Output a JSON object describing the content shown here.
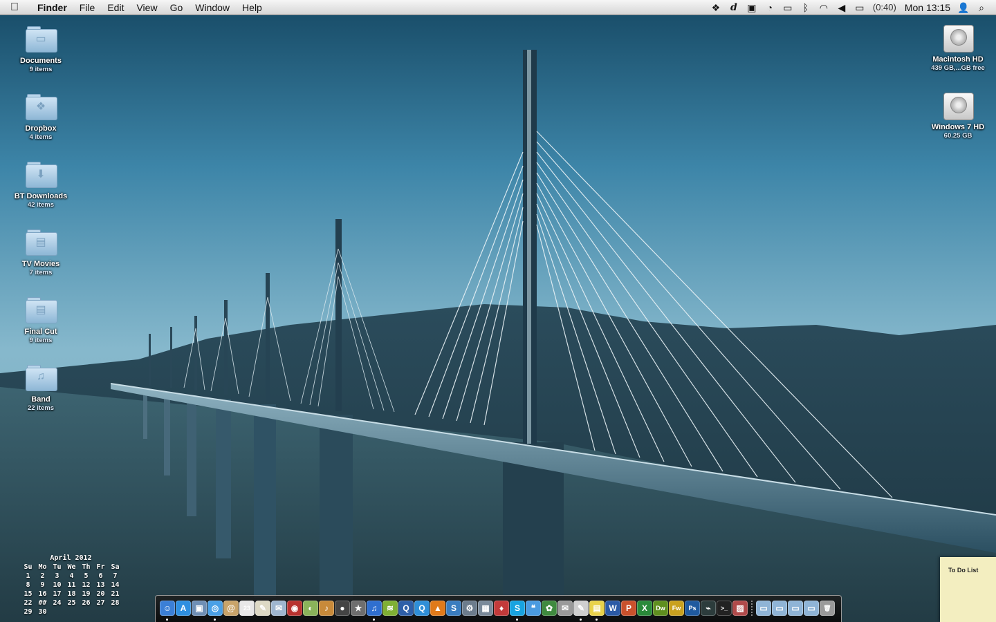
{
  "menubar": {
    "apple_icon": "apple-logo-icon",
    "app_name": "Finder",
    "menus": [
      "File",
      "Edit",
      "View",
      "Go",
      "Window",
      "Help"
    ],
    "status_icons": [
      "dropbox-icon",
      "dashcode-icon",
      "airplay-icon",
      "time-machine-icon",
      "display-icon",
      "bluetooth-icon",
      "wifi-icon",
      "volume-icon"
    ],
    "battery_icon": "battery-charging-icon",
    "battery_time": "(0:40)",
    "clock": "Mon 13:15",
    "user_icon": "user-icon",
    "spotlight_icon": "spotlight-icon"
  },
  "desktop_left": [
    {
      "name": "Documents",
      "sub": "9 items",
      "icon": "folder-documents-icon",
      "mark": "▭"
    },
    {
      "name": "Dropbox",
      "sub": "4 items",
      "icon": "folder-dropbox-icon",
      "mark": "❖"
    },
    {
      "name": "BT Downloads",
      "sub": "42 items",
      "icon": "folder-downloads-icon",
      "mark": "⬇"
    },
    {
      "name": "TV Movies",
      "sub": "7 items",
      "icon": "folder-movies-icon",
      "mark": "▤"
    },
    {
      "name": "Final Cut",
      "sub": "9 items",
      "icon": "folder-movies-icon",
      "mark": "▤"
    },
    {
      "name": "Band",
      "sub": "22 items",
      "icon": "folder-music-icon",
      "mark": "♫"
    }
  ],
  "desktop_right": [
    {
      "name": "Macintosh HD",
      "sub": "439 GB,...GB free",
      "icon": "hard-drive-icon"
    },
    {
      "name": "Windows 7 HD",
      "sub": "60.25 GB",
      "icon": "hard-drive-icon"
    }
  ],
  "calendar": {
    "title": "April 2012",
    "weekdays": [
      "Su",
      "Mo",
      "Tu",
      "We",
      "Th",
      "Fr",
      "Sa"
    ],
    "weeks": [
      [
        "1",
        "2",
        "3",
        "4",
        "5",
        "6",
        "7"
      ],
      [
        "8",
        "9",
        "10",
        "11",
        "12",
        "13",
        "14"
      ],
      [
        "15",
        "16",
        "17",
        "18",
        "19",
        "20",
        "21"
      ],
      [
        "22",
        "##",
        "24",
        "25",
        "26",
        "27",
        "28"
      ],
      [
        "29",
        "30",
        "",
        "",
        "",
        "",
        ""
      ]
    ]
  },
  "sticky": {
    "title": "To Do List"
  },
  "dock": {
    "apps": [
      {
        "name": "finder-icon",
        "glyph": "☺",
        "color": "#3b7fd6",
        "running": true
      },
      {
        "name": "app-store-icon",
        "glyph": "A",
        "color": "#2f8fe0",
        "running": false
      },
      {
        "name": "preview-icon",
        "glyph": "▣",
        "color": "#6f8fb5",
        "running": false
      },
      {
        "name": "safari-icon",
        "glyph": "◎",
        "color": "#4aa0e6",
        "running": true
      },
      {
        "name": "address-book-icon",
        "glyph": "@",
        "color": "#c9a46a",
        "running": false
      },
      {
        "name": "ical-icon",
        "glyph": "23",
        "color": "#e8e8e8",
        "running": false
      },
      {
        "name": "textedit-icon",
        "glyph": "✎",
        "color": "#ddd9c5",
        "running": false
      },
      {
        "name": "mail-stamp-icon",
        "glyph": "✉",
        "color": "#9fb6cf",
        "running": false
      },
      {
        "name": "photo-booth-icon",
        "glyph": "◉",
        "color": "#b8322f",
        "running": false
      },
      {
        "name": "iphoto-icon",
        "glyph": "◐",
        "color": "#8ab35a",
        "running": false
      },
      {
        "name": "garageband-icon",
        "glyph": "♪",
        "color": "#c88a3a",
        "running": false
      },
      {
        "name": "dvd-player-icon",
        "glyph": "●",
        "color": "#444444",
        "running": false
      },
      {
        "name": "imovie-icon",
        "glyph": "★",
        "color": "#6e6e6e",
        "running": false
      },
      {
        "name": "itunes-icon",
        "glyph": "♫",
        "color": "#2f6fcf",
        "running": true
      },
      {
        "name": "spotify-icon",
        "glyph": "≋",
        "color": "#7fb034",
        "running": false
      },
      {
        "name": "quicktime-icon",
        "glyph": "Q",
        "color": "#2e5fa8",
        "running": false
      },
      {
        "name": "quicktime-x-icon",
        "glyph": "Q",
        "color": "#2f8fd8",
        "running": false
      },
      {
        "name": "vlc-icon",
        "glyph": "▲",
        "color": "#e07a1a",
        "running": false
      },
      {
        "name": "stream-app-icon",
        "glyph": "S",
        "color": "#3a7dbf",
        "running": false
      },
      {
        "name": "system-preferences-icon",
        "glyph": "⚙",
        "color": "#6c7c8c",
        "running": false
      },
      {
        "name": "photo-app-icon",
        "glyph": "▦",
        "color": "#7a8a9a",
        "running": false
      },
      {
        "name": "utility-app-icon",
        "glyph": "♦",
        "color": "#c23a3a",
        "running": false
      },
      {
        "name": "skype-icon",
        "glyph": "S",
        "color": "#18a3e0",
        "running": true
      },
      {
        "name": "messages-icon",
        "glyph": "❝",
        "color": "#4a9be0",
        "running": false
      },
      {
        "name": "adium-icon",
        "glyph": "✿",
        "color": "#3f8a3f",
        "running": false
      },
      {
        "name": "scripting-icon",
        "glyph": "✉",
        "color": "#9a9a9a",
        "running": false
      },
      {
        "name": "pages-icon",
        "glyph": "✎",
        "color": "#cfcfcf",
        "running": true
      },
      {
        "name": "stickies-icon",
        "glyph": "▤",
        "color": "#e8d24a",
        "running": true
      },
      {
        "name": "word-icon",
        "glyph": "W",
        "color": "#2b5aa6",
        "running": false
      },
      {
        "name": "powerpoint-icon",
        "glyph": "P",
        "color": "#c9512c",
        "running": false
      },
      {
        "name": "excel-icon",
        "glyph": "X",
        "color": "#2a8a3a",
        "running": false
      },
      {
        "name": "dreamweaver-icon",
        "glyph": "Dw",
        "color": "#5f8f1f",
        "running": false
      },
      {
        "name": "fireworks-icon",
        "glyph": "Fw",
        "color": "#c9a11f",
        "running": false
      },
      {
        "name": "photoshop-icon",
        "glyph": "Ps",
        "color": "#1f5a9f",
        "running": false
      },
      {
        "name": "activity-monitor-icon",
        "glyph": "⌁",
        "color": "#2c3c3c",
        "running": false
      },
      {
        "name": "terminal-icon",
        "glyph": ">_",
        "color": "#222222",
        "running": false
      },
      {
        "name": "image-app-icon",
        "glyph": "▨",
        "color": "#b04a4a",
        "running": false
      }
    ],
    "stacks": [
      {
        "name": "applications-stack-icon",
        "glyph": "▭",
        "color": "#8fb4d6"
      },
      {
        "name": "documents-stack-icon",
        "glyph": "▭",
        "color": "#8fb4d6"
      },
      {
        "name": "downloads-stack-icon",
        "glyph": "▭",
        "color": "#8fb4d6"
      },
      {
        "name": "folder-stack-icon",
        "glyph": "▭",
        "color": "#8fb4d6"
      },
      {
        "name": "trash-icon",
        "glyph": "🗑",
        "color": "#9a9a9a"
      }
    ]
  }
}
